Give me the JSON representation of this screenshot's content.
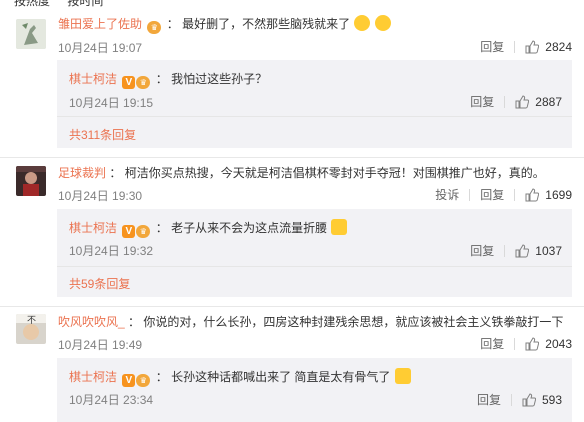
{
  "topbar": {
    "left": "按热度",
    "right": "按时间"
  },
  "comments": [
    {
      "user": "雏田爱上了佐助",
      "text": "最好删了，不然那些脑残就来了",
      "time": "10月24日 19:07",
      "reply_label": "回复",
      "likes": "2824",
      "replies": [
        {
          "user": "棋士柯洁",
          "text": "我怕过这些孙子？",
          "time": "10月24日 19:15",
          "reply_label": "回复",
          "likes": "2887"
        }
      ],
      "more_replies": "共311条回复"
    },
    {
      "user": "足球裁判",
      "text": "柯洁你买点热搜，今天就是柯洁倡棋杯零封对手夺冠！对围棋推广也好，真的。",
      "time": "10月24日 19:30",
      "report_label": "投诉",
      "reply_label": "回复",
      "likes": "1699",
      "replies": [
        {
          "user": "棋士柯洁",
          "text": "老子从来不会为这点流量折腰",
          "time": "10月24日 19:32",
          "reply_label": "回复",
          "likes": "1037"
        }
      ],
      "more_replies": "共59条回复"
    },
    {
      "user": "吹风吹吹风_",
      "text": "你说的对，什么长孙，四房这种封建残余思想，就应该被社会主义铁拳敲打一下",
      "time": "10月24日 19:49",
      "reply_label": "回复",
      "likes": "2043",
      "replies": [
        {
          "user": "棋士柯洁",
          "text": "长孙这种话都喊出来了 简直是太有骨气了",
          "time": "10月24日 23:34",
          "reply_label": "回复",
          "likes": "593"
        }
      ]
    }
  ],
  "avatar_texts": {
    "c3": "不"
  },
  "badges": {
    "v": "V",
    "level": "♛"
  },
  "colors": {
    "username": "#eb7350",
    "meta": "#808080",
    "reply_bg": "#f2f2f5",
    "emoji": "#ffcc33"
  }
}
